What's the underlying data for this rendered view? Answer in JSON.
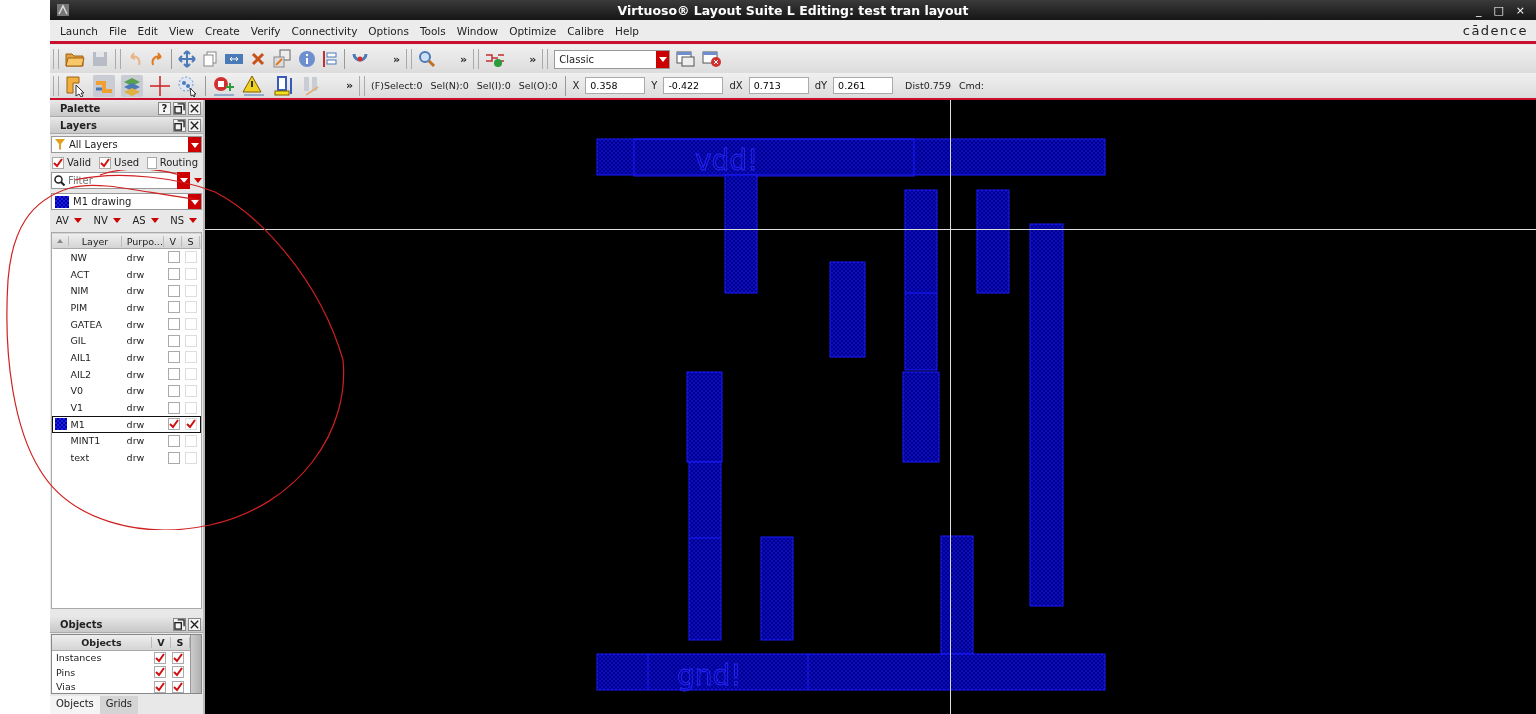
{
  "window": {
    "title": "Virtuoso® Layout Suite L Editing: test tran layout",
    "controls": [
      "_",
      "□",
      "×"
    ]
  },
  "menu": [
    "Launch",
    "File",
    "Edit",
    "View",
    "Create",
    "Verify",
    "Connectivity",
    "Options",
    "Tools",
    "Window",
    "Optimize",
    "Calibre",
    "Help"
  ],
  "brand": "cādence",
  "toolbar_1": {
    "overflow": [
      "»",
      "»",
      "»"
    ],
    "view_dropdown": "Classic"
  },
  "toolbar_2": {
    "overflow": "»",
    "status": [
      "(F)Select:0",
      "Sel(N):0",
      "Sel(I):0",
      "Sel(O):0"
    ],
    "fields": [
      {
        "label": "X",
        "value": "0.358"
      },
      {
        "label": "Y",
        "value": "-0.422"
      },
      {
        "label": "dX",
        "value": "0.713"
      },
      {
        "label": "dY",
        "value": "0.261"
      }
    ],
    "dist": "Dist0.759",
    "cmd": "Cmd:"
  },
  "palette": {
    "title": "Palette",
    "help": "?"
  },
  "layers_panel": {
    "title": "Layers",
    "filter_dropdown": "All Layers",
    "checkboxes": [
      {
        "label": "Valid",
        "checked": true
      },
      {
        "label": "Used",
        "checked": true
      },
      {
        "label": "Routing",
        "checked": false
      }
    ],
    "filter_placeholder": "Filter",
    "current_layer": "M1 drawing",
    "visibility_menus": [
      "AV",
      "NV",
      "AS",
      "NS"
    ],
    "columns": [
      "Layer",
      "Purpo...",
      "V",
      "S"
    ],
    "rows": [
      {
        "layer": "NW",
        "purpose": "drw",
        "visible": false,
        "selectable": false,
        "selected": false
      },
      {
        "layer": "ACT",
        "purpose": "drw",
        "visible": false,
        "selectable": false,
        "selected": false
      },
      {
        "layer": "NIM",
        "purpose": "drw",
        "visible": false,
        "selectable": false,
        "selected": false
      },
      {
        "layer": "PIM",
        "purpose": "drw",
        "visible": false,
        "selectable": false,
        "selected": false
      },
      {
        "layer": "GATEA",
        "purpose": "drw",
        "visible": false,
        "selectable": false,
        "selected": false
      },
      {
        "layer": "GIL",
        "purpose": "drw",
        "visible": false,
        "selectable": false,
        "selected": false
      },
      {
        "layer": "AIL1",
        "purpose": "drw",
        "visible": false,
        "selectable": false,
        "selected": false
      },
      {
        "layer": "AIL2",
        "purpose": "drw",
        "visible": false,
        "selectable": false,
        "selected": false
      },
      {
        "layer": "V0",
        "purpose": "drw",
        "visible": false,
        "selectable": false,
        "selected": false
      },
      {
        "layer": "V1",
        "purpose": "drw",
        "visible": false,
        "selectable": false,
        "selected": false
      },
      {
        "layer": "M1",
        "purpose": "drw",
        "visible": true,
        "selectable": true,
        "selected": true
      },
      {
        "layer": "MINT1",
        "purpose": "drw",
        "visible": false,
        "selectable": false,
        "selected": false
      },
      {
        "layer": "text",
        "purpose": "drw",
        "visible": false,
        "selectable": false,
        "selected": false
      }
    ]
  },
  "objects_panel": {
    "title": "Objects",
    "columns": [
      "Objects",
      "V",
      "S"
    ],
    "rows": [
      {
        "name": "Instances",
        "visible": true,
        "selectable": true
      },
      {
        "name": "Pins",
        "visible": true,
        "selectable": true
      },
      {
        "name": "Vias",
        "visible": true,
        "selectable": true
      }
    ],
    "tabs": [
      {
        "label": "Objects",
        "selected": true
      },
      {
        "label": "Grids",
        "selected": false
      }
    ]
  },
  "canvas": {
    "labels": [
      "vdd!",
      "gnd!"
    ]
  }
}
